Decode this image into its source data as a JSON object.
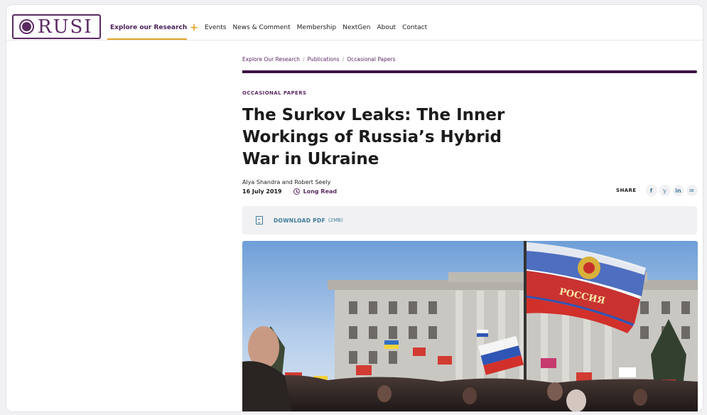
{
  "nav": {
    "logo_text": "RUSI",
    "items": [
      {
        "label": "Explore our Research",
        "active": true
      },
      {
        "label": "Events"
      },
      {
        "label": "News & Comment"
      },
      {
        "label": "Membership"
      },
      {
        "label": "NextGen"
      },
      {
        "label": "About"
      },
      {
        "label": "Contact"
      }
    ],
    "plus": "+"
  },
  "breadcrumb": {
    "items": [
      "Explore Our Research",
      "Publications",
      "Occasional Papers"
    ],
    "separator": "/"
  },
  "article": {
    "eyebrow": "OCCASIONAL PAPERS",
    "title": "The Surkov Leaks: The Inner Workings of Russia’s Hybrid War in Ukraine",
    "authors": "Alya Shandra and Robert Seely",
    "date": "16 July 2019",
    "read_type": "Long Read"
  },
  "share": {
    "label": "SHARE",
    "buttons": [
      {
        "icon": "facebook-icon",
        "glyph": "f"
      },
      {
        "icon": "twitter-icon",
        "glyph": "𝕪"
      },
      {
        "icon": "linkedin-icon",
        "glyph": "in"
      },
      {
        "icon": "email-icon",
        "glyph": "✉"
      }
    ]
  },
  "download": {
    "label": "DOWNLOAD PDF",
    "size": "(2MB)"
  },
  "hero": {
    "flag_text": "РОССИЯ"
  },
  "colors": {
    "brand_purple": "#5b2a63",
    "accent_gold": "#e0a526",
    "link_teal": "#3f7b9a"
  }
}
